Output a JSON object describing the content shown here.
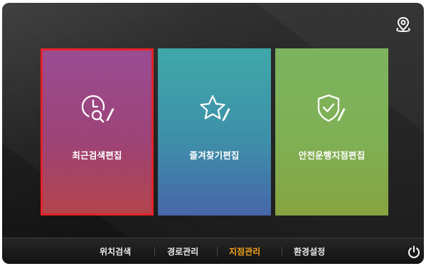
{
  "header": {
    "map_button_icon": "location-pin-icon"
  },
  "cards": {
    "recent_search_edit": {
      "label": "최근검색편집",
      "icon": "clock-search-edit-icon",
      "color": "#9d4377",
      "selected": true
    },
    "favorites_edit": {
      "label": "즐겨찾기편집",
      "icon": "star-edit-icon",
      "color": "#3e8fa9"
    },
    "safe_driving_point_edit": {
      "label": "안전운행지점편집",
      "icon": "shield-check-edit-icon",
      "color": "#7fb054"
    }
  },
  "bottom_nav": {
    "tabs": [
      {
        "label": "위치검색",
        "active": false
      },
      {
        "label": "경로관리",
        "active": false
      },
      {
        "label": "지점관리",
        "active": true
      },
      {
        "label": "환경설정",
        "active": false
      }
    ],
    "active_color": "#f4a21c",
    "power_icon": "power-icon"
  }
}
